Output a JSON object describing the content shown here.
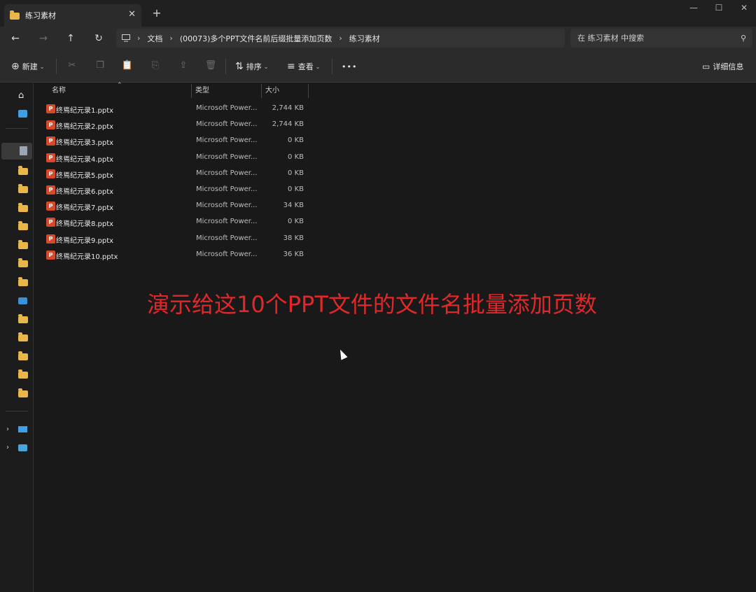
{
  "window": {
    "tab_title": "练习素材",
    "tab_close": "✕",
    "new_tab": "+",
    "controls": [
      "—",
      "☐",
      "✕"
    ]
  },
  "nav": {
    "back": "←",
    "forward": "→",
    "up": "↑",
    "refresh": "↻"
  },
  "breadcrumb": {
    "device_icon": "monitor-icon",
    "separator": "›",
    "items": [
      "文档",
      "(00073)多个PPT文件名前后缀批量添加页数",
      "练习素材"
    ]
  },
  "search": {
    "placeholder": "在 练习素材 中搜索",
    "icon": "search-icon"
  },
  "toolbar": {
    "new_label": "新建",
    "sort_label": "排序",
    "view_label": "查看",
    "more_label": "•••",
    "details_label": "详细信息"
  },
  "columns": {
    "name": "名称",
    "type": "类型",
    "size": "大小"
  },
  "files": [
    {
      "name": "终焉纪元录1.pptx",
      "type": "Microsoft Power...",
      "size": "2,744 KB"
    },
    {
      "name": "终焉纪元录2.pptx",
      "type": "Microsoft Power...",
      "size": "2,744 KB"
    },
    {
      "name": "终焉纪元录3.pptx",
      "type": "Microsoft Power...",
      "size": "0 KB"
    },
    {
      "name": "终焉纪元录4.pptx",
      "type": "Microsoft Power...",
      "size": "0 KB"
    },
    {
      "name": "终焉纪元录5.pptx",
      "type": "Microsoft Power...",
      "size": "0 KB"
    },
    {
      "name": "终焉纪元录6.pptx",
      "type": "Microsoft Power...",
      "size": "0 KB"
    },
    {
      "name": "终焉纪元录7.pptx",
      "type": "Microsoft Power...",
      "size": "34 KB"
    },
    {
      "name": "终焉纪元录8.pptx",
      "type": "Microsoft Power...",
      "size": "0 KB"
    },
    {
      "name": "终焉纪元录9.pptx",
      "type": "Microsoft Power...",
      "size": "38 KB"
    },
    {
      "name": "终焉纪元录10.pptx",
      "type": "Microsoft Power...",
      "size": "36 KB"
    }
  ],
  "overlay_caption": "演示给这10个PPT文件的文件名批量添加页数",
  "colors": {
    "folder": "#e9b64a",
    "ppt_icon": "#d44a2a",
    "caption": "#e0282a"
  }
}
